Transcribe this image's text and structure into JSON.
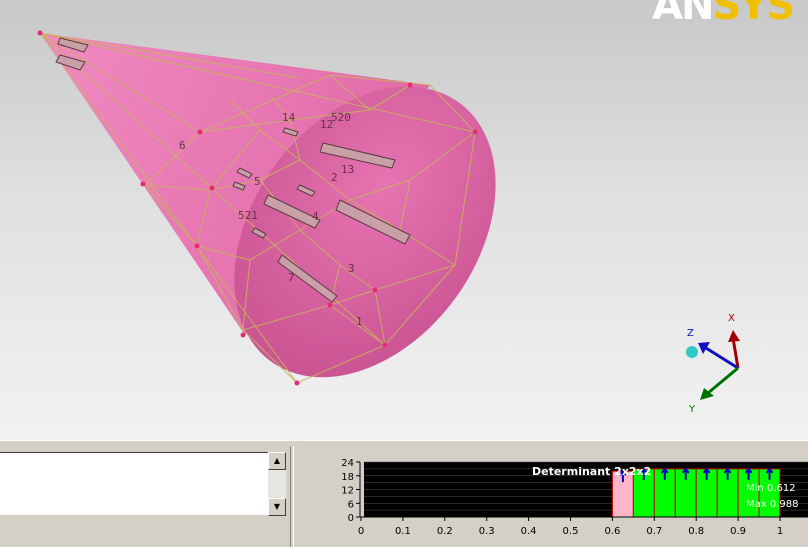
{
  "logo": {
    "part1": "AN",
    "part2": "SYS"
  },
  "scene": {
    "labels": [
      {
        "text": "14"
      },
      {
        "text": "12"
      },
      {
        "text": "520"
      },
      {
        "text": "6"
      },
      {
        "text": "13"
      },
      {
        "text": "5"
      },
      {
        "text": "2"
      },
      {
        "text": "521"
      },
      {
        "text": "4"
      },
      {
        "text": "3"
      },
      {
        "text": "7"
      },
      {
        "text": "1"
      }
    ],
    "colors": {
      "cone": "#e774b2",
      "mesh": "#c8b457",
      "point": "#e8287a"
    }
  },
  "axes": {
    "x": "X",
    "y": "Y",
    "z": "Z"
  },
  "log_panel": {
    "text": ""
  },
  "histogram": {
    "title": "Determinant 2x2x2",
    "min_label": "Min 0.612",
    "max_label": "Max 0.988",
    "y_ticks": [
      "24",
      "18",
      "12",
      "6",
      "0"
    ],
    "x_ticks": [
      "0",
      "0.1",
      "0.2",
      "0.3",
      "0.4",
      "0.5",
      "0.6",
      "0.7",
      "0.8",
      "0.9",
      "1"
    ]
  },
  "chart_data": {
    "type": "bar",
    "title": "Determinant 2x2x2",
    "xlim": [
      0,
      1
    ],
    "ylim": [
      0,
      24
    ],
    "bins": [
      {
        "x0": 0.6,
        "x1": 0.65,
        "count": 20,
        "color": "#ffb6c8"
      },
      {
        "x0": 0.65,
        "x1": 0.7,
        "count": 21,
        "color": "#00ff00"
      },
      {
        "x0": 0.7,
        "x1": 0.75,
        "count": 21,
        "color": "#00ff00"
      },
      {
        "x0": 0.75,
        "x1": 0.8,
        "count": 21,
        "color": "#00ff00"
      },
      {
        "x0": 0.8,
        "x1": 0.85,
        "count": 21,
        "color": "#00ff00"
      },
      {
        "x0": 0.85,
        "x1": 0.9,
        "count": 21,
        "color": "#00ff00"
      },
      {
        "x0": 0.9,
        "x1": 0.95,
        "count": 21,
        "color": "#00ff00"
      },
      {
        "x0": 0.95,
        "x1": 1.0,
        "count": 21,
        "color": "#00ff00"
      }
    ]
  }
}
